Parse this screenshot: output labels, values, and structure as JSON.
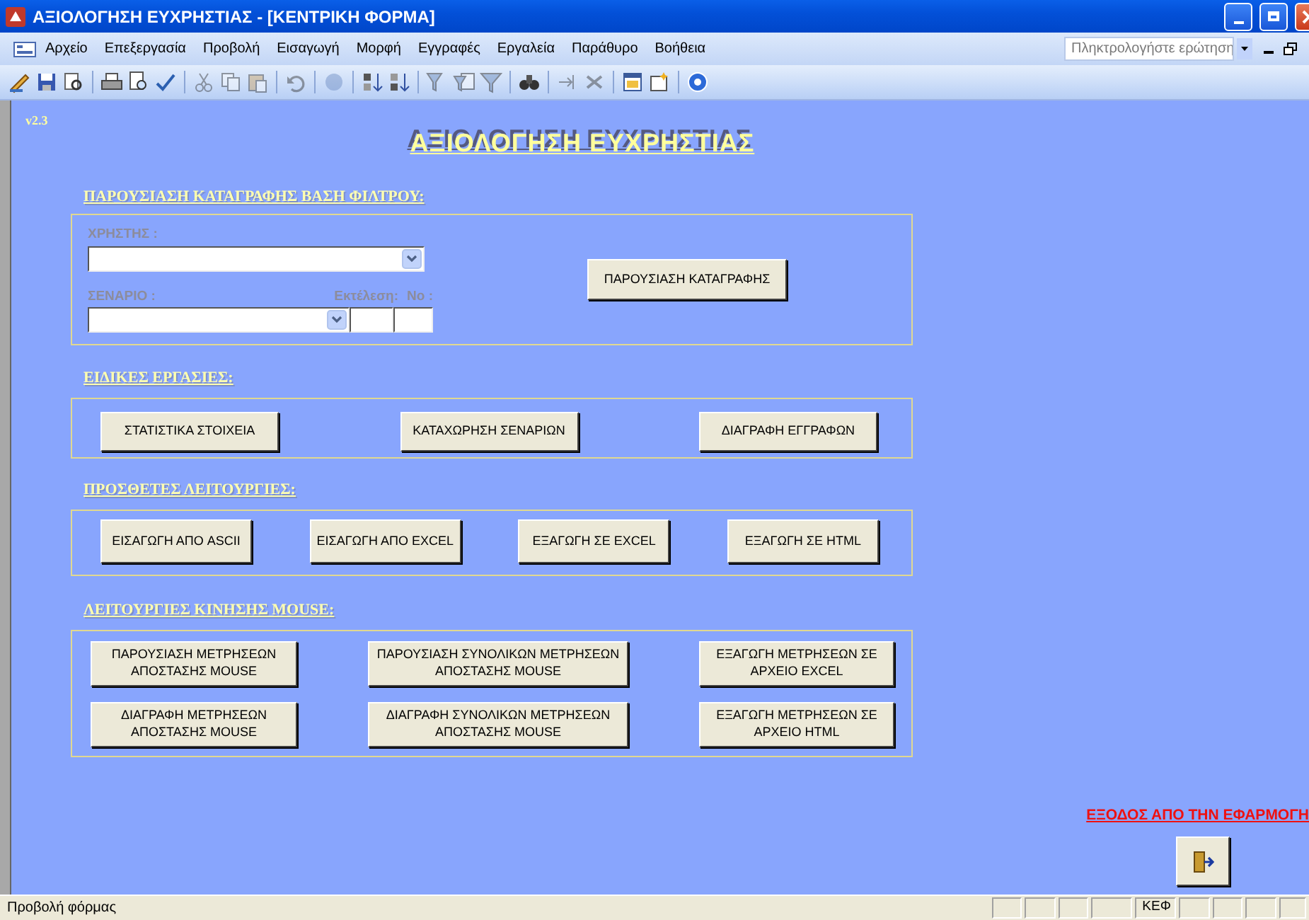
{
  "window": {
    "title": "ΑΞΙΟΛΟΓΗΣΗ ΕΥΧΡΗΣΤΙΑΣ - [ΚΕΝΤΡΙΚΗ ΦΟΡΜΑ]"
  },
  "menu": [
    "Αρχείο",
    "Επεξεργασία",
    "Προβολή",
    "Εισαγωγή",
    "Μορφή",
    "Εγγραφές",
    "Εργαλεία",
    "Παράθυρο",
    "Βοήθεια"
  ],
  "help_search": {
    "placeholder": "Πληκτρολογήστε ερώτηση"
  },
  "form": {
    "version": "v2.3",
    "title": "ΑΞΙΟΛΟΓΗΣΗ ΕΥΧΡΗΣΤΙΑΣ",
    "filter": {
      "heading": "ΠΑΡΟΥΣΙΑΣΗ  ΚΑΤΑΓΡΑΦΗΣ ΒΑΣΗ ΦΙΛΤΡΟΥ:",
      "user_label": "ΧΡΗΣΤΗΣ :",
      "scenario_label": "ΣΕΝΑΡΙΟ :",
      "run_label": "Εκτέλεση:",
      "no_label": "Νο :",
      "button": "ΠΑΡΟΥΣΙΑΣΗ ΚΑΤΑΓΡΑΦΗΣ"
    },
    "sections": [
      {
        "heading": "ΕΙΔΙΚΕΣ ΕΡΓΑΣΙΕΣ:",
        "buttons": [
          "ΣΤΑΤΙΣΤΙΚΑ ΣΤΟΙΧΕΙΑ",
          "ΚΑΤΑΧΩΡΗΣΗ ΣΕΝΑΡΙΩΝ",
          "ΔΙΑΓΡΑΦΗ ΕΓΓΡΑΦΩΝ"
        ]
      },
      {
        "heading": "ΠΡΟΣΘΕΤΕΣ ΛΕΙΤΟΥΡΓΙΕΣ:",
        "buttons": [
          "ΕΙΣΑΓΩΓΗ ΑΠΟ ASCII",
          "ΕΙΣΑΓΩΓΗ ΑΠΟ EXCEL",
          "ΕΞΑΓΩΓΗ ΣΕ EXCEL",
          "ΕΞΑΓΩΓΗ ΣΕ HTML"
        ]
      },
      {
        "heading": "ΛΕΙΤΟΥΡΓΙΕΣ ΚΙΝΗΣΗΣ MOUSE:",
        "buttons": [
          "ΠΑΡΟΥΣΙΑΣΗ ΜΕΤΡΗΣΕΩΝ ΑΠΟΣΤΑΣΗΣ MOUSE",
          "ΠΑΡΟΥΣΙΑΣΗ ΣΥΝΟΛΙΚΩΝ ΜΕΤΡΗΣΕΩΝ ΑΠΟΣΤΑΣΗΣ MOUSE",
          "ΕΞΑΓΩΓΗ ΜΕΤΡΗΣΕΩΝ ΣΕ ΑΡΧΕΙΟ EXCEL",
          "ΔΙΑΓΡΑΦΗ ΜΕΤΡΗΣΕΩΝ ΑΠΟΣΤΑΣΗΣ MOUSE",
          "ΔΙΑΓΡΑΦΗ ΣΥΝΟΛΙΚΩΝ ΜΕΤΡΗΣΕΩΝ ΑΠΟΣΤΑΣΗΣ MOUSE",
          "ΕΞΑΓΩΓΗ ΜΕΤΡΗΣΕΩΝ ΣΕ ΑΡΧΕΙΟ HTML"
        ]
      }
    ],
    "exit_label": "ΕΞΟΔΟΣ ΑΠΟ ΤΗΝ ΕΦΑΡΜΟΓΗ"
  },
  "status_bar": {
    "text": "Προβολή φόρμας",
    "indicator": "ΚΕΦ"
  }
}
